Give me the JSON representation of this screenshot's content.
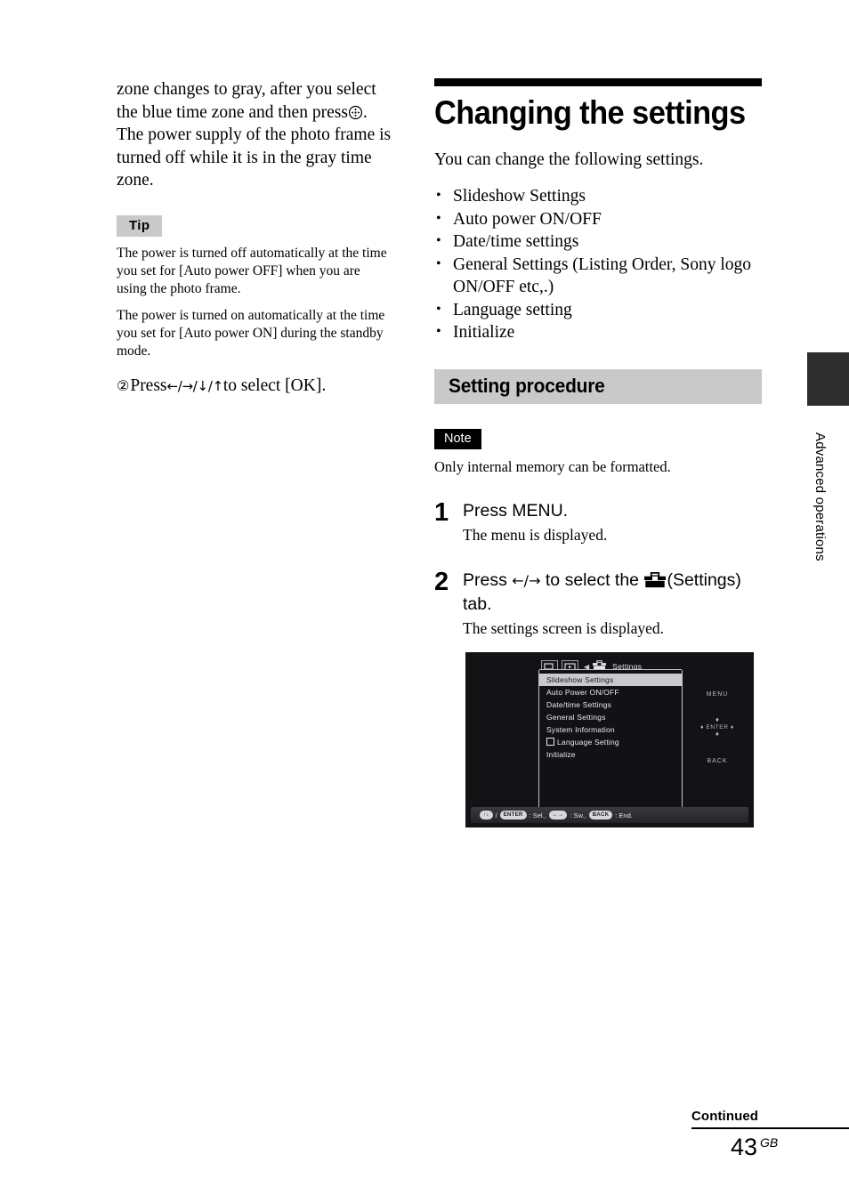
{
  "left_column": {
    "paragraph": "zone changes to gray, after you select the blue time zone and then press",
    "paragraph_tail": ". The power supply of the photo frame is turned off while it is in the gray time zone.",
    "dpad_icon": "dpad-circle-icon",
    "tip_label": "Tip",
    "tip_paragraphs": [
      "The power is turned off automatically at the time you set  for [Auto power OFF] when you are using the photo frame.",
      "The power is turned on automatically at the time you set for [Auto power ON] during the standby mode."
    ],
    "step": {
      "number": "②",
      "text_before": "Press ",
      "arrows": "←/→/↓/↑",
      "text_after": " to select [OK]."
    }
  },
  "right_column": {
    "chapter_title": "Changing the settings",
    "intro": "You can change the following settings.",
    "bullets": [
      "Slideshow Settings",
      "Auto power ON/OFF",
      "Date/time settings",
      "General Settings (Listing Order, Sony logo ON/OFF etc,.)",
      "Language setting",
      "Initialize"
    ],
    "section_band_title": "Setting procedure",
    "note_label": "Note",
    "note_text": "Only internal memory can be formatted.",
    "steps": [
      {
        "number": "1",
        "head": "Press MENU.",
        "head_arrows": "",
        "head_tail": "",
        "sub": "The menu is displayed."
      },
      {
        "number": "2",
        "head": "Press ",
        "head_arrows": "←/→",
        "head_tail": " to select the ",
        "head_icon": "toolbox-icon",
        "head_tail2": "(Settings) tab.",
        "sub": "The settings screen is displayed."
      }
    ]
  },
  "device_screenshot": {
    "tabs": [
      {
        "icon": "single-photo-icon"
      },
      {
        "icon": "slideshow-play-icon"
      }
    ],
    "left_caret": "◀",
    "active_tab_icon": "toolbox-icon",
    "active_tab_label": "Settings",
    "menu_items": [
      {
        "label": "Slideshow Settings",
        "selected": true,
        "icon": ""
      },
      {
        "label": "Auto Power ON/OFF",
        "selected": false,
        "icon": ""
      },
      {
        "label": "Date/time Settings",
        "selected": false,
        "icon": ""
      },
      {
        "label": "General Settings",
        "selected": false,
        "icon": ""
      },
      {
        "label": "System Information",
        "selected": false,
        "icon": ""
      },
      {
        "label": "Language Setting",
        "selected": false,
        "icon": "language-glyph-icon"
      },
      {
        "label": "Initialize",
        "selected": false,
        "icon": ""
      }
    ],
    "right_keys": {
      "menu": "MENU",
      "enter": "ENTER",
      "back": "BACK",
      "up_arrow": "♦",
      "down_arrow": "♦",
      "left_arrow": "♦",
      "right_arrow": "♦"
    },
    "status_bar": {
      "pill1": "↑↓",
      "sep1": "/",
      "pill2": "ENTER",
      "text1": ": Sel.,",
      "pill3": "←→",
      "text2": ": Sw.,",
      "pill4": "BACK",
      "text3": ": End."
    }
  },
  "margin_tab": {
    "label": "Advanced operations",
    "color": "#2e2e2e"
  },
  "footer": {
    "continued": "Continued",
    "page_number": "43",
    "page_suffix": "GB"
  }
}
